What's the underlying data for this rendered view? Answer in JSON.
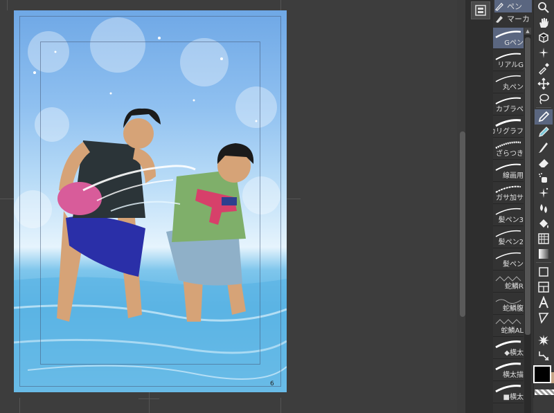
{
  "document": {
    "page_number": "6"
  },
  "brush_tabs": [
    {
      "label": "ペン",
      "active": true
    },
    {
      "label": "マーカ",
      "active": false
    }
  ],
  "brushes": [
    {
      "label": "Gペン",
      "active": true
    },
    {
      "label": "リアルG",
      "active": false
    },
    {
      "label": "丸ペン",
      "active": false
    },
    {
      "label": "カブラペ",
      "active": false
    },
    {
      "label": "カリグラフ",
      "active": false
    },
    {
      "label": "ざらつき",
      "active": false
    },
    {
      "label": "線画用",
      "active": false
    },
    {
      "label": "ガサ加サ",
      "active": false
    },
    {
      "label": "髪ペン3",
      "active": false
    },
    {
      "label": "髪ペン2",
      "active": false
    },
    {
      "label": "髪ペン",
      "active": false
    },
    {
      "label": "蛇鱗R",
      "active": false
    },
    {
      "label": "蛇鱗腹",
      "active": false
    },
    {
      "label": "蛇鱗AL",
      "active": false
    },
    {
      "label": "◆横太",
      "active": false
    },
    {
      "label": "横太描",
      "active": false
    },
    {
      "label": "■横太",
      "active": false
    }
  ],
  "tools": [
    {
      "icon": "zoom-icon",
      "active": false
    },
    {
      "icon": "hand-icon",
      "active": false
    },
    {
      "icon": "object-select-icon",
      "active": false
    },
    {
      "icon": "auto-select-icon",
      "active": false
    },
    {
      "icon": "eyedropper-icon",
      "active": false
    },
    {
      "icon": "move-icon",
      "active": false
    },
    {
      "icon": "lasso-icon",
      "active": false
    },
    {
      "icon": "pen-icon",
      "active": true
    },
    {
      "icon": "pencil-icon",
      "active": false
    },
    {
      "icon": "brush-icon",
      "active": false
    },
    {
      "icon": "eraser-icon",
      "active": false
    },
    {
      "icon": "airbrush-icon",
      "active": false
    },
    {
      "icon": "decoration-icon",
      "active": false
    },
    {
      "icon": "blend-icon",
      "active": false
    },
    {
      "icon": "fill-icon",
      "active": false
    },
    {
      "icon": "gradient-icon",
      "active": false
    },
    {
      "icon": "figure-icon",
      "active": false
    },
    {
      "icon": "frame-icon",
      "active": false
    },
    {
      "icon": "text-icon",
      "active": false
    },
    {
      "icon": "balloon-icon",
      "active": false
    },
    {
      "icon": "effect-line-icon",
      "active": false
    },
    {
      "icon": "correct-line-icon",
      "active": false
    }
  ],
  "colors": {
    "main": "#000000",
    "sub": "#c8a888",
    "accent": "#5a6680"
  }
}
